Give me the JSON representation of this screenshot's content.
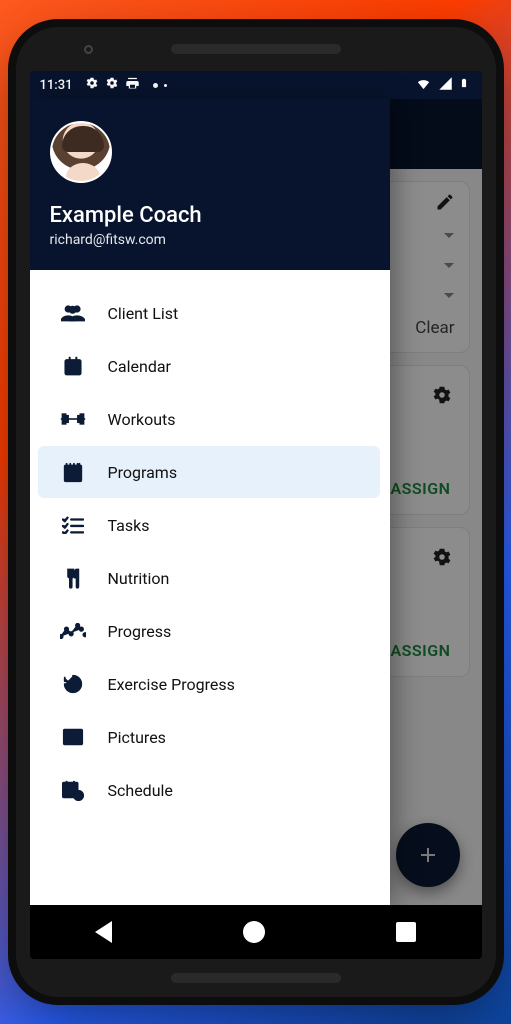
{
  "status": {
    "time": "11:31"
  },
  "profile": {
    "name": "Example Coach",
    "email": "richard@fitsw.com"
  },
  "drawer": [
    {
      "key": "client-list",
      "label": "Client List",
      "sel": false
    },
    {
      "key": "calendar",
      "label": "Calendar",
      "sel": false
    },
    {
      "key": "workouts",
      "label": "Workouts",
      "sel": false
    },
    {
      "key": "programs",
      "label": "Programs",
      "sel": true
    },
    {
      "key": "tasks",
      "label": "Tasks",
      "sel": false
    },
    {
      "key": "nutrition",
      "label": "Nutrition",
      "sel": false
    },
    {
      "key": "progress",
      "label": "Progress",
      "sel": false
    },
    {
      "key": "exercise-progress",
      "label": "Exercise Progress",
      "sel": false
    },
    {
      "key": "pictures",
      "label": "Pictures",
      "sel": false
    },
    {
      "key": "schedule",
      "label": "Schedule",
      "sel": false
    }
  ],
  "bg": {
    "clear_label": "Clear",
    "assign_label": "ASSIGN"
  }
}
